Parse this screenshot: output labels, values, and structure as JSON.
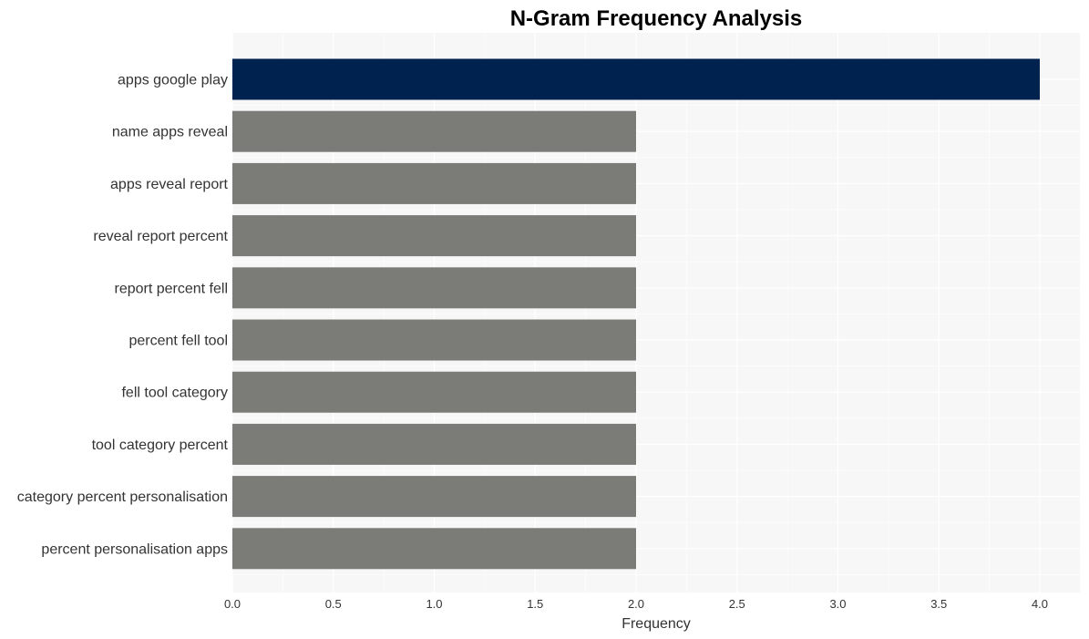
{
  "chart_data": {
    "type": "bar",
    "orientation": "horizontal",
    "title": "N-Gram Frequency Analysis",
    "xlabel": "Frequency",
    "ylabel": "",
    "xlim": [
      0,
      4.2
    ],
    "xticks": [
      0.0,
      0.5,
      1.0,
      1.5,
      2.0,
      2.5,
      3.0,
      3.5,
      4.0
    ],
    "xtick_labels": [
      "0.0",
      "0.5",
      "1.0",
      "1.5",
      "2.0",
      "2.5",
      "3.0",
      "3.5",
      "4.0"
    ],
    "grid": true,
    "legend": "none",
    "categories": [
      "apps google play",
      "name apps reveal",
      "apps reveal report",
      "reveal report percent",
      "report percent fell",
      "percent fell tool",
      "fell tool category",
      "tool category percent",
      "category percent personalisation",
      "percent personalisation apps"
    ],
    "values": [
      4,
      2,
      2,
      2,
      2,
      2,
      2,
      2,
      2,
      2
    ],
    "colors": {
      "highlight": "#00224e",
      "default": "#7b7b77",
      "plot_background": "#f7f7f7",
      "grid": "#ffffff"
    }
  }
}
